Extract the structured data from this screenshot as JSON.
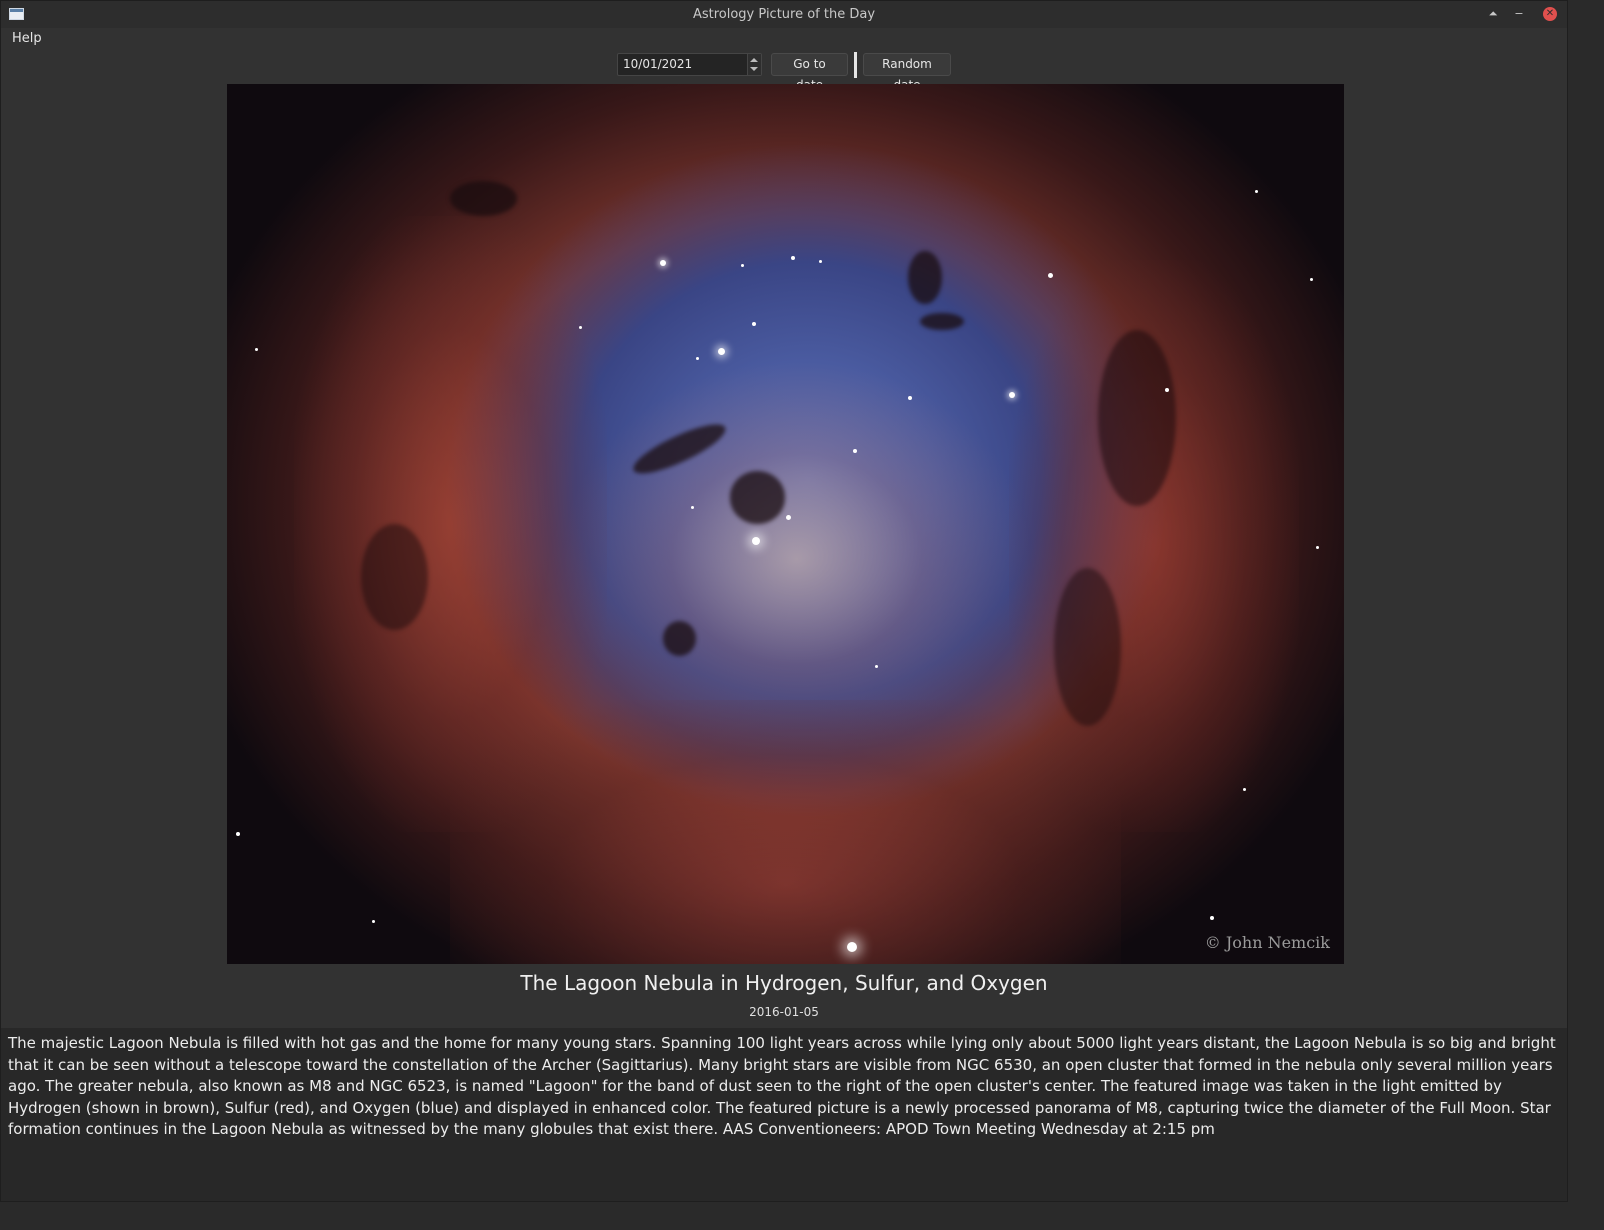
{
  "window": {
    "title": "Astrology Picture of the Day",
    "controls": {
      "keep_above": "⏶",
      "minimize": "−",
      "close": "✕"
    }
  },
  "menubar": {
    "items": [
      {
        "label": "Help"
      }
    ]
  },
  "toolbar": {
    "date_value": "10/01/2021",
    "go_label": "Go to date",
    "random_label": "Random date"
  },
  "picture": {
    "watermark": "© John Nemcik",
    "title": "The Lagoon Nebula in Hydrogen, Sulfur, and Oxygen",
    "date": "2016-01-05",
    "description": "The majestic Lagoon Nebula is filled with hot gas and the home for many young stars. Spanning 100 light years across while lying only about 5000 light years distant, the Lagoon Nebula is so big and bright that it can be seen without a telescope toward the constellation of the Archer (Sagittarius).  Many bright stars are visible from NGC 6530, an open cluster that formed in the nebula only several million years ago. The greater nebula, also known as M8 and NGC 6523, is named \"Lagoon\" for the band of dust seen to the right of the open cluster's center. The featured image was taken in the light emitted by Hydrogen (shown in brown), Sulfur (red), and Oxygen (blue) and displayed in enhanced color. The featured picture is a newly processed panorama of M8, capturing twice the diameter of the Full Moon. Star formation continues in the Lagoon Nebula as witnessed by the many globules that exist there.   AAS Conventioneers: APOD Town Meeting Wednesday at 2:15 pm"
  },
  "colors": {
    "background": "#323232",
    "close_button": "#e0504e"
  }
}
